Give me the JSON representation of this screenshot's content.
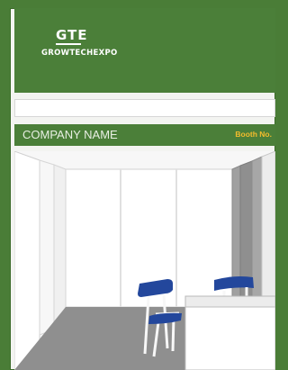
{
  "header": {
    "logo_main": "GTE",
    "logo_sub": "GROWTECHEXPO"
  },
  "fascia": {
    "company_name": "COMPANY NAME",
    "booth_label": "Booth No."
  },
  "colors": {
    "green": "#4b7f39",
    "booth_text": "#f4bc2c",
    "chair_blue": "#23479c"
  },
  "scene_items": [
    "booth-wall-left",
    "booth-wall-back",
    "booth-wall-right",
    "booth-floor",
    "chair-left",
    "chair-right",
    "counter"
  ]
}
